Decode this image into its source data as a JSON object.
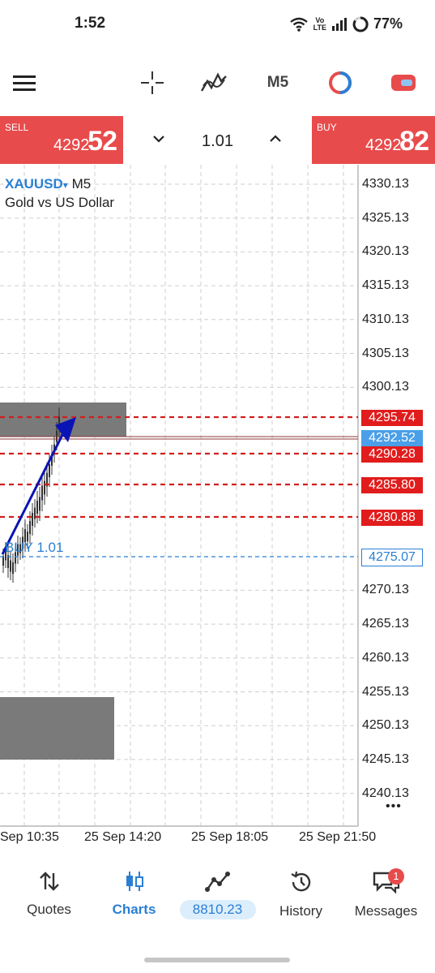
{
  "status": {
    "time": "1:52",
    "battery": "77%",
    "volte": "Vo\nLTE"
  },
  "toolbar": {
    "timeframe": "M5"
  },
  "trade": {
    "sell_label": "SELL",
    "sell_price_small": "4292.",
    "sell_price_big": "52",
    "buy_label": "BUY",
    "buy_price_small": "4292.",
    "buy_price_big": "82",
    "lot": "1.01"
  },
  "chart": {
    "symbol": "XAUUSD",
    "symbol_arrow": "▾",
    "timeframe": "M5",
    "description": "Gold vs US Dollar",
    "order_label": "BUY 1.01",
    "price_axis": [
      "4330.13",
      "4325.13",
      "4320.13",
      "4315.13",
      "4310.13",
      "4305.13",
      "4300.13",
      "4270.13",
      "4265.13",
      "4260.13",
      "4255.13",
      "4250.13",
      "4245.13",
      "4240.13"
    ],
    "tags": {
      "sl_top": "4295.74",
      "current": "4292.52",
      "level_2": "4290.28",
      "level_3": "4285.80",
      "level_4": "4280.88",
      "entry": "4275.07"
    },
    "time_axis": [
      "Sep 10:35",
      "25 Sep 14:20",
      "25 Sep 18:05",
      "25 Sep 21:50"
    ],
    "more": "•••"
  },
  "nav": {
    "quotes": "Quotes",
    "charts": "Charts",
    "balance": "8810.23",
    "history": "History",
    "messages": "Messages",
    "messages_badge": "1"
  },
  "colors": {
    "red": "#e84b4b",
    "blue": "#2a7fd4",
    "dark_blue": "#0a14b4",
    "gray_zone": "#7a7a7a"
  }
}
